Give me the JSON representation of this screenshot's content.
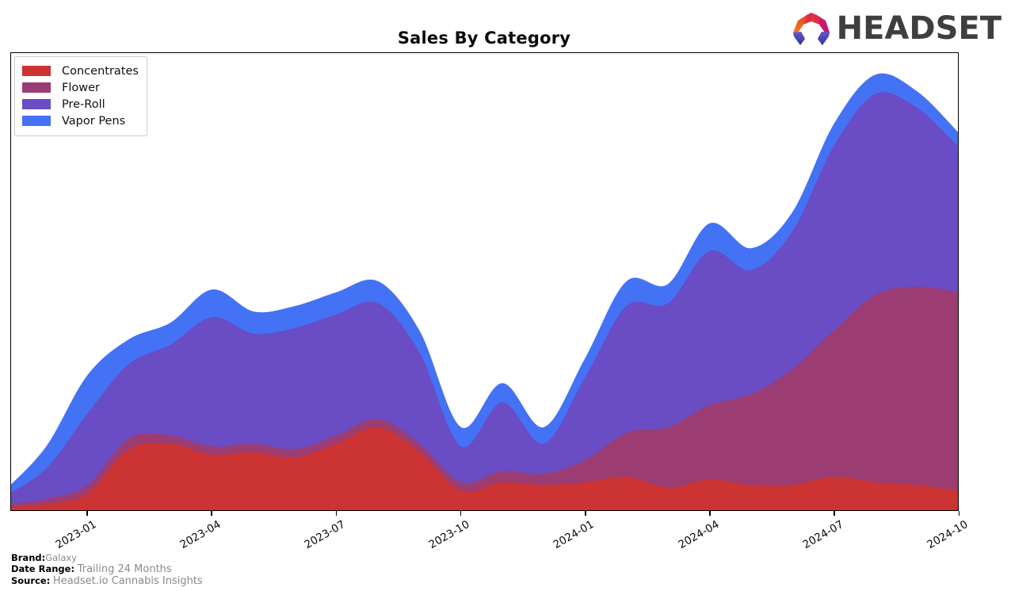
{
  "header": {
    "title": "Sales By Category",
    "logo_text": "HEADSET",
    "logo_icon": "headset-hexagon-icon"
  },
  "legend": {
    "position": "upper-left",
    "items": [
      {
        "label": "Concentrates",
        "color": "#cc3333"
      },
      {
        "label": "Flower",
        "color": "#9b3d72"
      },
      {
        "label": "Pre-Roll",
        "color": "#6a4cc4"
      },
      {
        "label": "Vapor Pens",
        "color": "#4472f5"
      }
    ]
  },
  "footer": {
    "brand_key": "Brand:",
    "brand_value": "Galaxy",
    "date_range_key": "Date Range:",
    "date_range_value": "Trailing 24 Months",
    "source_key": "Source:",
    "source_value": "Headset.io Cannabis Insights"
  },
  "axis": {
    "x_ticks": [
      "2023-01",
      "2023-04",
      "2023-07",
      "2023-10",
      "2024-01",
      "2024-04",
      "2024-07",
      "2024-10"
    ],
    "y_ticks": [],
    "grid": false
  },
  "chart_data": {
    "type": "area",
    "stacked": true,
    "title": "Sales By Category",
    "xlabel": "",
    "ylabel": "",
    "grid": false,
    "legend_position": "upper left",
    "x": [
      "2022-11",
      "2022-12",
      "2023-01",
      "2023-02",
      "2023-03",
      "2023-04",
      "2023-05",
      "2023-06",
      "2023-07",
      "2023-08",
      "2023-09",
      "2023-10",
      "2023-11",
      "2023-12",
      "2024-01",
      "2024-02",
      "2024-03",
      "2024-04",
      "2024-05",
      "2024-06",
      "2024-07",
      "2024-08",
      "2024-09",
      "2024-10"
    ],
    "series": [
      {
        "name": "Concentrates",
        "color": "#cc3333",
        "values": [
          1,
          2,
          6,
          22,
          24,
          20,
          21,
          19,
          24,
          30,
          21,
          7,
          10,
          9,
          10,
          12,
          8,
          11,
          9,
          9,
          12,
          10,
          9,
          7
        ]
      },
      {
        "name": "Flower",
        "color": "#9b3d72",
        "values": [
          1,
          2,
          3,
          4,
          3,
          3,
          3,
          3,
          3,
          3,
          3,
          3,
          4,
          4,
          8,
          16,
          22,
          27,
          33,
          42,
          53,
          68,
          72,
          72
        ]
      },
      {
        "name": "Pre-Roll",
        "color": "#6a4cc4",
        "values": [
          3,
          11,
          26,
          27,
          33,
          47,
          40,
          44,
          44,
          42,
          33,
          13,
          25,
          11,
          30,
          46,
          45,
          56,
          45,
          50,
          67,
          73,
          65,
          53
        ]
      },
      {
        "name": "Vapor Pens",
        "color": "#4472f5",
        "values": [
          2,
          8,
          14,
          9,
          8,
          10,
          8,
          8,
          8,
          8,
          8,
          7,
          7,
          6,
          7,
          9,
          7,
          10,
          8,
          7,
          8,
          7,
          6,
          5
        ]
      }
    ],
    "total_peak": {
      "x": "2024-08",
      "value": 158
    },
    "ylim": [
      0,
      166
    ]
  }
}
